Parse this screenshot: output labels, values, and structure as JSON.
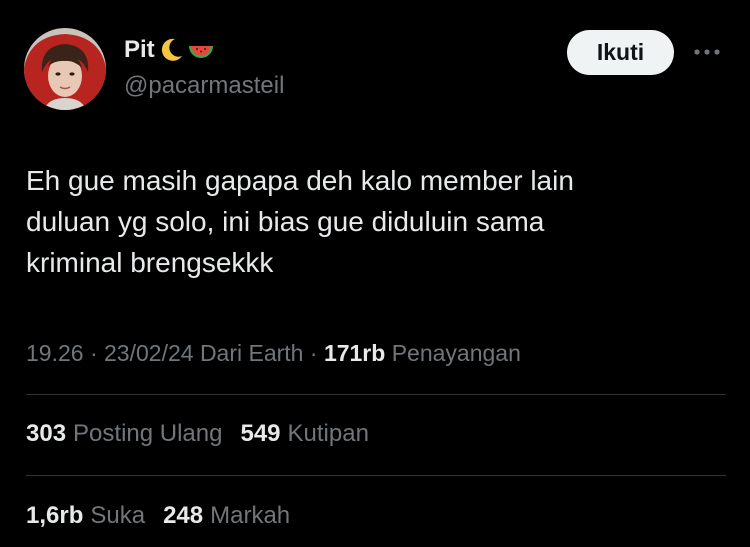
{
  "user": {
    "display_name": "Pit",
    "emojis": [
      "crescent-moon-icon",
      "watermelon-icon"
    ],
    "handle": "@pacarmasteil"
  },
  "follow_label": "Ikuti",
  "tweet": {
    "text": "Eh gue masih gapapa deh kalo member lain\nduluan yg solo, ini bias gue diduluin sama\nkriminal brengsekkk"
  },
  "meta": {
    "time": "19.26",
    "sep1": "·",
    "date": "23/02/24",
    "source": "Dari Earth",
    "sep2": "·",
    "views_count": "171rb",
    "views_label": "Penayangan"
  },
  "stats": {
    "reposts_count": "303",
    "reposts_label": "Posting Ulang",
    "quotes_count": "549",
    "quotes_label": "Kutipan",
    "likes_count": "1,6rb",
    "likes_label": "Suka",
    "bookmarks_count": "248",
    "bookmarks_label": "Markah"
  },
  "colors": {
    "background": "#000000",
    "text_primary": "#e7e9ea",
    "text_secondary": "#71767b",
    "divider": "#2f3336",
    "button_bg": "#eff3f4",
    "button_text": "#0f1419"
  }
}
